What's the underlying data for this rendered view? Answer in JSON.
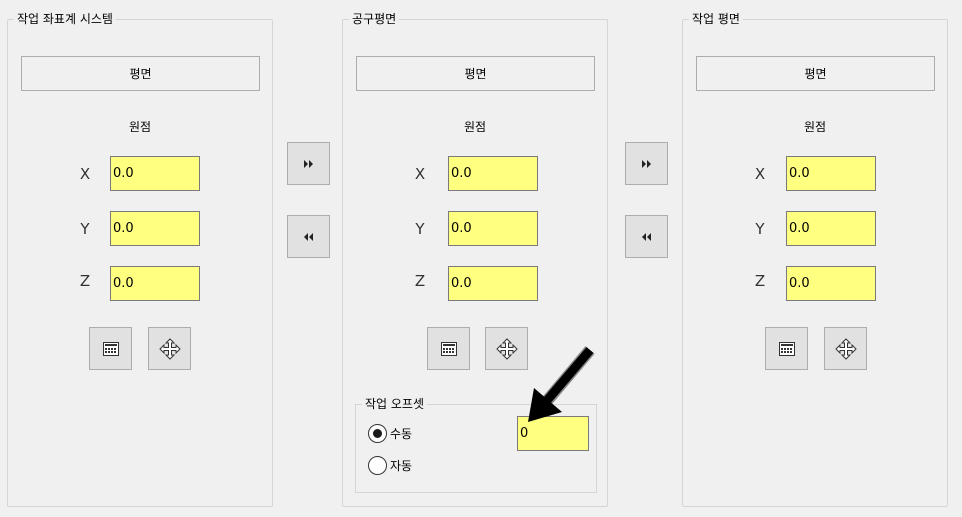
{
  "panels": [
    {
      "title": "작업 좌표계 시스템",
      "plane_button": "평면",
      "origin_label": "원점",
      "axes": [
        {
          "label": "X",
          "value": "0.0"
        },
        {
          "label": "Y",
          "value": "0.0"
        },
        {
          "label": "Z",
          "value": "0.0"
        }
      ]
    },
    {
      "title": "공구평면",
      "plane_button": "평면",
      "origin_label": "원점",
      "axes": [
        {
          "label": "X",
          "value": "0.0"
        },
        {
          "label": "Y",
          "value": "0.0"
        },
        {
          "label": "Z",
          "value": "0.0"
        }
      ],
      "work_offset": {
        "title": "작업 오프셋",
        "manual_label": "수동",
        "auto_label": "자동",
        "selected": "manual",
        "value": "0"
      }
    },
    {
      "title": "작업 평면",
      "plane_button": "평면",
      "origin_label": "원점",
      "axes": [
        {
          "label": "X",
          "value": "0.0"
        },
        {
          "label": "Y",
          "value": "0.0"
        },
        {
          "label": "Z",
          "value": "0.0"
        }
      ]
    }
  ],
  "icons": {
    "forward": "double-right-arrow-icon",
    "back": "double-left-arrow-icon",
    "calculator": "calculator-icon",
    "move": "move-cross-arrows-icon",
    "annotation": "black-pointer-arrow-icon"
  },
  "colors": {
    "background": "#f0f0f0",
    "input_bg": "#ffff80",
    "border": "#adadad"
  }
}
